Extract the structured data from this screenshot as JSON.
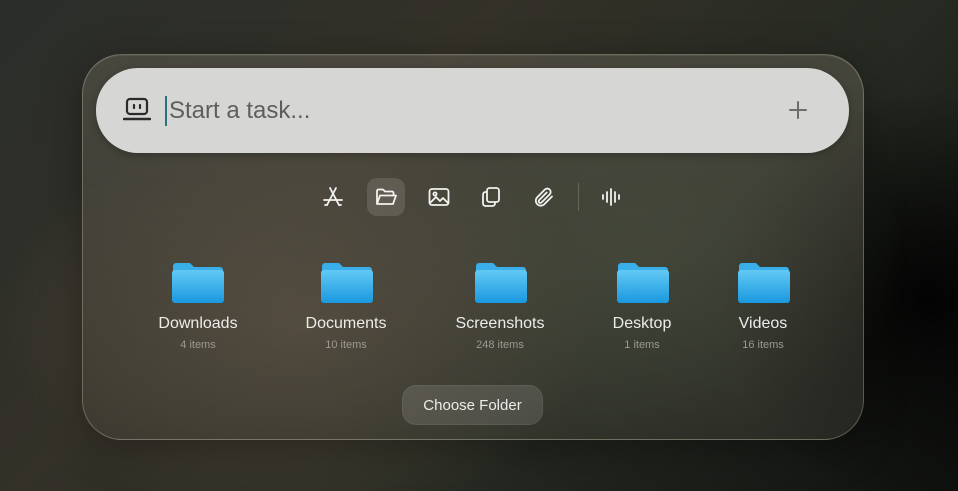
{
  "search": {
    "placeholder": "Start a task...",
    "value": ""
  },
  "toolbar": {
    "items": [
      {
        "icon": "app-store-icon"
      },
      {
        "icon": "folder-open-icon",
        "active": true
      },
      {
        "icon": "image-icon"
      },
      {
        "icon": "copy-icon"
      },
      {
        "icon": "paperclip-icon"
      },
      {
        "icon": "waveform-icon"
      }
    ]
  },
  "folders": [
    {
      "name": "Downloads",
      "count": "4 items"
    },
    {
      "name": "Documents",
      "count": "10 items"
    },
    {
      "name": "Screenshots",
      "count": "248 items"
    },
    {
      "name": "Desktop",
      "count": "1 items"
    },
    {
      "name": "Videos",
      "count": "16 items"
    }
  ],
  "choose_folder_label": "Choose Folder",
  "colors": {
    "folder_top": "#5cc6f2",
    "folder_bottom": "#1c9be0",
    "caret": "#2c6f7e"
  }
}
